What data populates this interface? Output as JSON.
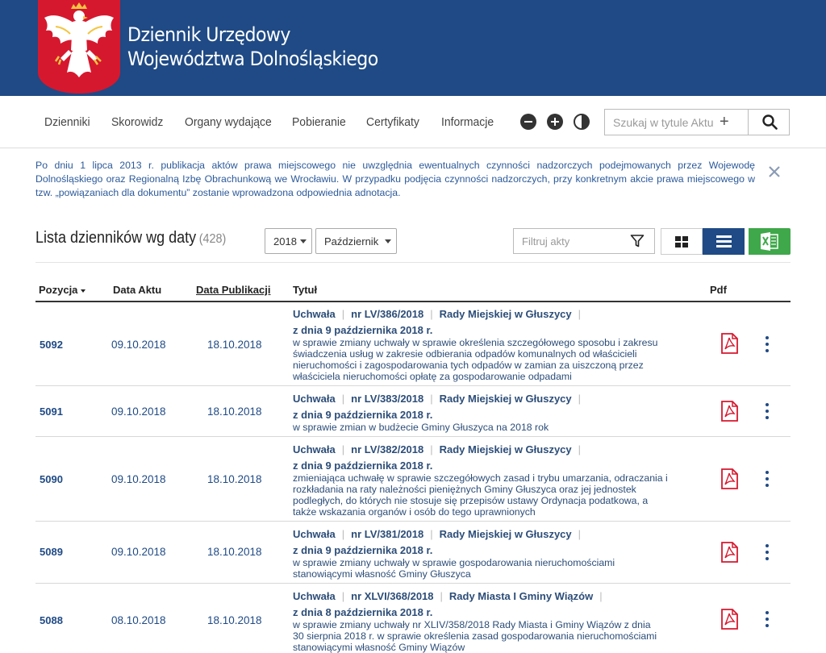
{
  "header": {
    "title_line1": "Dziennik Urzędowy",
    "title_line2": "Województwa Dolnośląskiego",
    "colors": {
      "brand": "#1f4a85",
      "emblem": "#d6182e"
    }
  },
  "nav": {
    "items": [
      "Dzienniki",
      "Skorowidz",
      "Organy wydające",
      "Pobieranie",
      "Certyfikaty",
      "Informacje"
    ],
    "tools": [
      "zoom-out-icon",
      "zoom-in-icon",
      "contrast-icon"
    ],
    "search": {
      "placeholder": "Szukaj w tytule Aktu",
      "plus": "+",
      "icon": "search-icon"
    }
  },
  "notice": {
    "text": "Po dniu 1 lipca 2013 r. publikacja aktów prawa miejscowego nie uwzględnia ewentualnych czynności nadzorczych podejmowanych przez Wojewodę Dolnośląskiego oraz Regionalną Izbę Obrachunkową we Wrocławiu. W przypadku podjęcia czynności nadzorczych, przy konkretnym akcie prawa miejscowego w tzw. „powiązaniach dla dokumentu” zostanie wprowadzona odpowiednia adnotacja."
  },
  "list": {
    "title": "Lista dzienników wg daty",
    "count": "(428)",
    "year": "2018",
    "month": "Październik",
    "filter_placeholder": "Filtruj akty",
    "excel_color": "#3fa84a"
  },
  "table": {
    "headers": {
      "position": "Pozycja",
      "act_date": "Data Aktu",
      "pub_date": "Data Publikacji",
      "title": "Tytuł",
      "pdf": "Pdf"
    },
    "rows": [
      {
        "position": "5092",
        "act_date": "09.10.2018",
        "pub_date": "18.10.2018",
        "type": "Uchwała",
        "number": "nr LV/386/2018",
        "body": "Rady Miejskiej w Głuszycy",
        "date_line": "z dnia 9 października 2018 r.",
        "desc_lines": [
          "w sprawie zmiany uchwały w sprawie określenia szczegółowego sposobu i zakresu",
          "świadczenia usług w zakresie odbierania odpadów komunalnych od właścicieli",
          "nieruchomości i zagospodarowania tych odpadów w zamian za uiszczoną przez",
          "właściciela nieruchomości opłatę za gospodarowanie odpadami"
        ]
      },
      {
        "position": "5091",
        "act_date": "09.10.2018",
        "pub_date": "18.10.2018",
        "type": "Uchwała",
        "number": "nr LV/383/2018",
        "body": "Rady Miejskiej w Głuszycy",
        "date_line": "z dnia 9 października 2018 r.",
        "desc_lines": [
          "w sprawie zmian w budżecie Gminy Głuszyca na 2018 rok"
        ]
      },
      {
        "position": "5090",
        "act_date": "09.10.2018",
        "pub_date": "18.10.2018",
        "type": "Uchwała",
        "number": "nr LV/382/2018",
        "body": "Rady Miejskiej w Głuszycy",
        "date_line": "z dnia 9 października 2018 r.",
        "desc_lines": [
          "zmieniająca uchwałę w sprawie szczegółowych zasad i trybu umarzania, odraczania i",
          "rozkładania na raty należności pieniężnych Gminy Głuszyca oraz jej jednostek",
          "podległych, do których nie stosuje się przepisów ustawy Ordynacja podatkowa, a",
          "także wskazania organów i osób do tego uprawnionych"
        ]
      },
      {
        "position": "5089",
        "act_date": "09.10.2018",
        "pub_date": "18.10.2018",
        "type": "Uchwała",
        "number": "nr LV/381/2018",
        "body": "Rady Miejskiej w Głuszycy",
        "date_line": "z dnia 9 października 2018 r.",
        "desc_lines": [
          "w sprawie zmiany uchwały w sprawie gospodarowania nieruchomościami",
          "stanowiącymi własność Gminy Głuszyca"
        ]
      },
      {
        "position": "5088",
        "act_date": "08.10.2018",
        "pub_date": "18.10.2018",
        "type": "Uchwała",
        "number": "nr XLVI/368/2018",
        "body": "Rady Miasta I Gminy Wiązów",
        "date_line": "z dnia 8 października 2018 r.",
        "desc_lines": [
          "w sprawie zmiany uchwały nr XLIV/358/2018 Rady Miasta i Gminy Wiązów z dnia",
          "30 sierpnia 2018 r. w sprawie określenia zasad gospodarowania nieruchomościami",
          "stanowiącymi własność Gminy Wiązów"
        ]
      }
    ]
  }
}
